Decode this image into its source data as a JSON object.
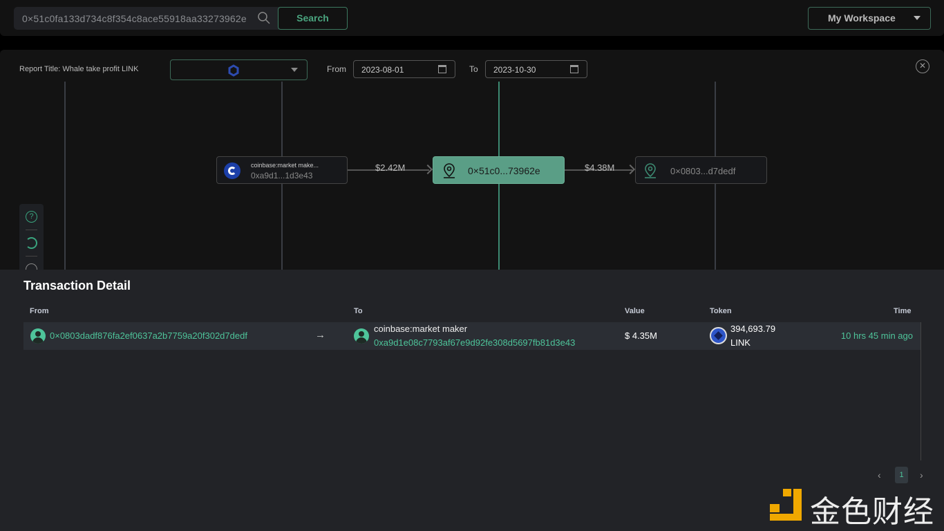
{
  "topbar": {
    "search_value": "0×51c0fa133d734c8f354c8ace55918aa33273962e",
    "search_label": "Search",
    "workspace_label": "My Workspace"
  },
  "filters": {
    "report_title": "Report Title: Whale take profit LINK",
    "token_icon": "chainlink-icon",
    "from_label": "From",
    "from_date": "2023-08-01",
    "to_label": "To",
    "to_date": "2023-10-30"
  },
  "graph": {
    "nodes": [
      {
        "label": "coinbase:market make...",
        "address": "0xa9d1...1d3e43",
        "icon": "coinbase-icon"
      },
      {
        "address": "0×51c0...73962e",
        "icon": "location-pin-icon",
        "highlighted": true
      },
      {
        "address": "0×0803...d7dedf",
        "icon": "location-pin-icon"
      }
    ],
    "edges": [
      {
        "value": "$2.42M"
      },
      {
        "value": "$4.38M"
      }
    ]
  },
  "colors": {
    "accent": "#4ec49a",
    "node_highlight": "#5a9e86",
    "logo": "#f0a800"
  },
  "detail": {
    "title": "Transaction Detail",
    "columns": [
      "From",
      "To",
      "Value",
      "Token",
      "Time"
    ],
    "rows": [
      {
        "from": "0×0803dadf876fa2ef0637a2b7759a20f302d7dedf",
        "to_label": "coinbase:market maker",
        "to": "0xa9d1e08c7793af67e9d92fe308d5697fb81d3e43",
        "value": "$ 4.35M",
        "token_amount": "394,693.79",
        "token_symbol": "LINK",
        "time": "10 hrs 45 min ago"
      }
    ],
    "page": "1"
  },
  "watermark": "金色财经"
}
